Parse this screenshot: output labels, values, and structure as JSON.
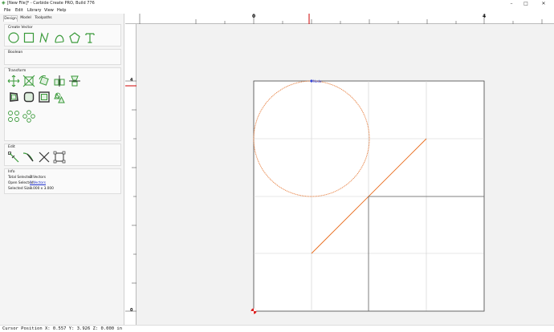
{
  "window": {
    "title": "[New File]* - Carbide Create PRO, Build 776",
    "icon": "carbide-icon",
    "controls": {
      "minimize": "–",
      "maximize": "□",
      "close": "✕"
    }
  },
  "menu": [
    {
      "label": "File"
    },
    {
      "label": "Edit"
    },
    {
      "label": "Library"
    },
    {
      "label": "View"
    },
    {
      "label": "Help"
    }
  ],
  "tabs": [
    {
      "label": "Design",
      "active": true
    },
    {
      "label": "Model",
      "active": false
    },
    {
      "label": "Toolpaths",
      "active": false
    }
  ],
  "groups": {
    "create_vector": {
      "title": "Create Vector",
      "tools": [
        "circle-tool-icon",
        "rectangle-tool-icon",
        "polyline-tool-icon",
        "curve-tool-icon",
        "polygon-tool-icon",
        "text-tool-icon"
      ]
    },
    "boolean": {
      "title": "Boolean"
    },
    "transform": {
      "title": "Transform",
      "tools": [
        "move-icon",
        "scale-icon",
        "rotate-icon",
        "mirror-icon",
        "align-icon",
        "offset-icon",
        "fillet-icon",
        "inside-box-icon",
        "array-icon",
        "circular-array-icon",
        "grid-icon",
        "pattern-icon"
      ]
    },
    "edit": {
      "title": "Edit",
      "tools": [
        "node-edit-icon",
        "trim-icon",
        "cut-icon",
        "bounding-box-icon"
      ]
    },
    "info": {
      "title": "Info",
      "rows": [
        {
          "label": "Total Selected:",
          "value": "2 Vectors"
        },
        {
          "label": "Open Selected:",
          "value": "1 Vectors"
        },
        {
          "label": "Selected Size:",
          "value": "3.000 x 3.000"
        }
      ]
    }
  },
  "rulers": {
    "top_labels": [
      "0",
      "4"
    ],
    "left_labels": [
      "4",
      "0"
    ]
  },
  "canvas": {
    "node_label": "Node",
    "colors": {
      "circle": "#e8864a",
      "line": "#e86a1a",
      "rect": "#666666",
      "grid": "#cfcfcf",
      "origin": "#dd2222",
      "cursor": "#cc0000"
    }
  },
  "status": {
    "cursor_text": "Cursor Position X: 0.557 Y: 3.926 Z: 0.000 in"
  }
}
